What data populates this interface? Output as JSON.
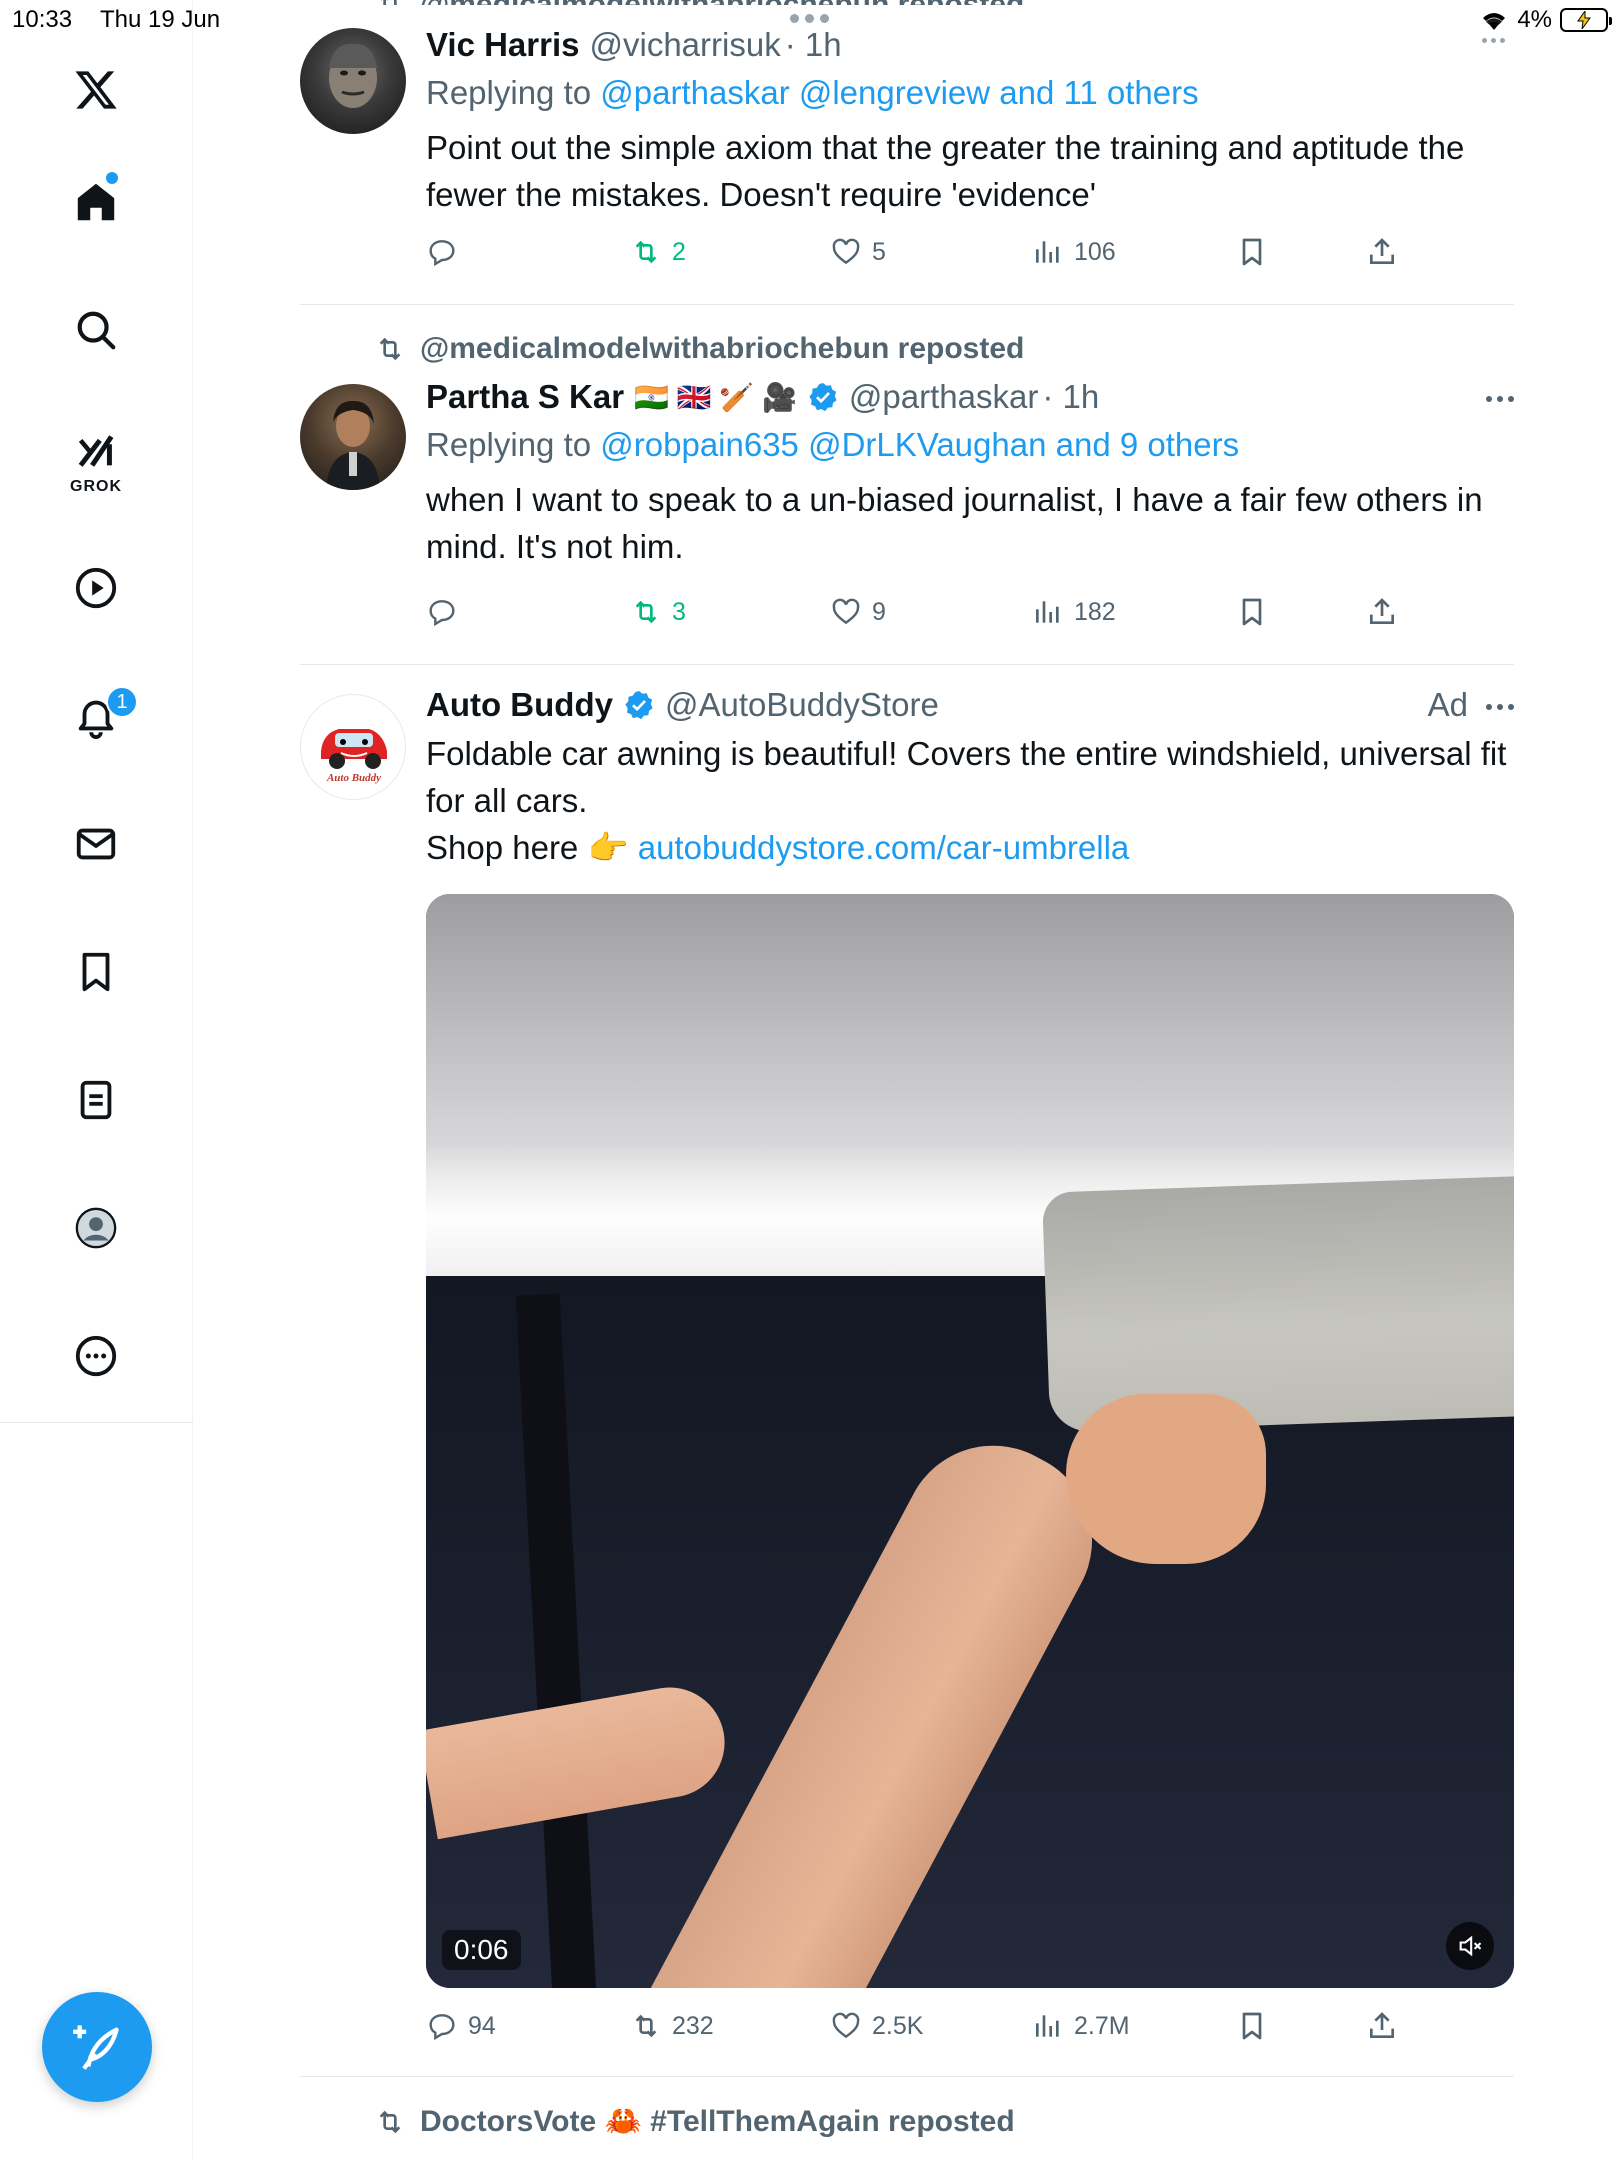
{
  "status_bar": {
    "time": "10:33",
    "date": "Thu 19 Jun",
    "battery": "4%"
  },
  "sidebar": {
    "grok_label": "GROK",
    "notifications_badge": "1",
    "items": [
      "x-logo",
      "home",
      "search",
      "grok",
      "video",
      "notifications",
      "messages",
      "bookmarks",
      "lists",
      "profile",
      "more"
    ]
  },
  "tweets": [
    {
      "repost_partial": "@medicalmodelwithabriochebun reposted",
      "name": "Vic Harris",
      "handle": "@vicharrisuk",
      "time": "· 1h",
      "reply_prefix": "Replying to ",
      "reply_targets": "@parthaskar @lengreview and 11 others",
      "text": "Point out the simple axiom that the greater the training and aptitude the fewer the mistakes. Doesn't require 'evidence'",
      "reposts": "2",
      "likes": "5",
      "views": "106"
    },
    {
      "repost_by": "@medicalmodelwithabriochebun reposted",
      "name": "Partha S Kar",
      "name_emoji": "🇮🇳 🇬🇧 🏏 🎥",
      "handle": "@parthaskar",
      "time": "· 1h",
      "reply_prefix": "Replying to ",
      "reply_targets": "@robpain635 @DrLKVaughan and 9 others",
      "text": "when I want to speak to a un-biased journalist, I have a fair few others in mind. It's not him.",
      "reposts": "3",
      "likes": "9",
      "views": "182"
    },
    {
      "name": "Auto Buddy",
      "handle": "@AutoBuddyStore",
      "ad_label": "Ad",
      "text": "Foldable car awning is beautiful! Covers the entire windshield, universal fit for all cars.",
      "shop_text": "Shop here 👉 ",
      "shop_link": "autobuddystore.com/car-umbrella",
      "avatar_label": "Auto Buddy",
      "video_time": "0:06",
      "replies": "94",
      "reposts": "232",
      "likes": "2.5K",
      "views": "2.7M"
    },
    {
      "repost_by": "DoctorsVote 🦀 #TellThemAgain reposted"
    }
  ],
  "colors": {
    "accent": "#1d9bf0",
    "repost_green": "#00ba7c",
    "muted": "#536471"
  }
}
